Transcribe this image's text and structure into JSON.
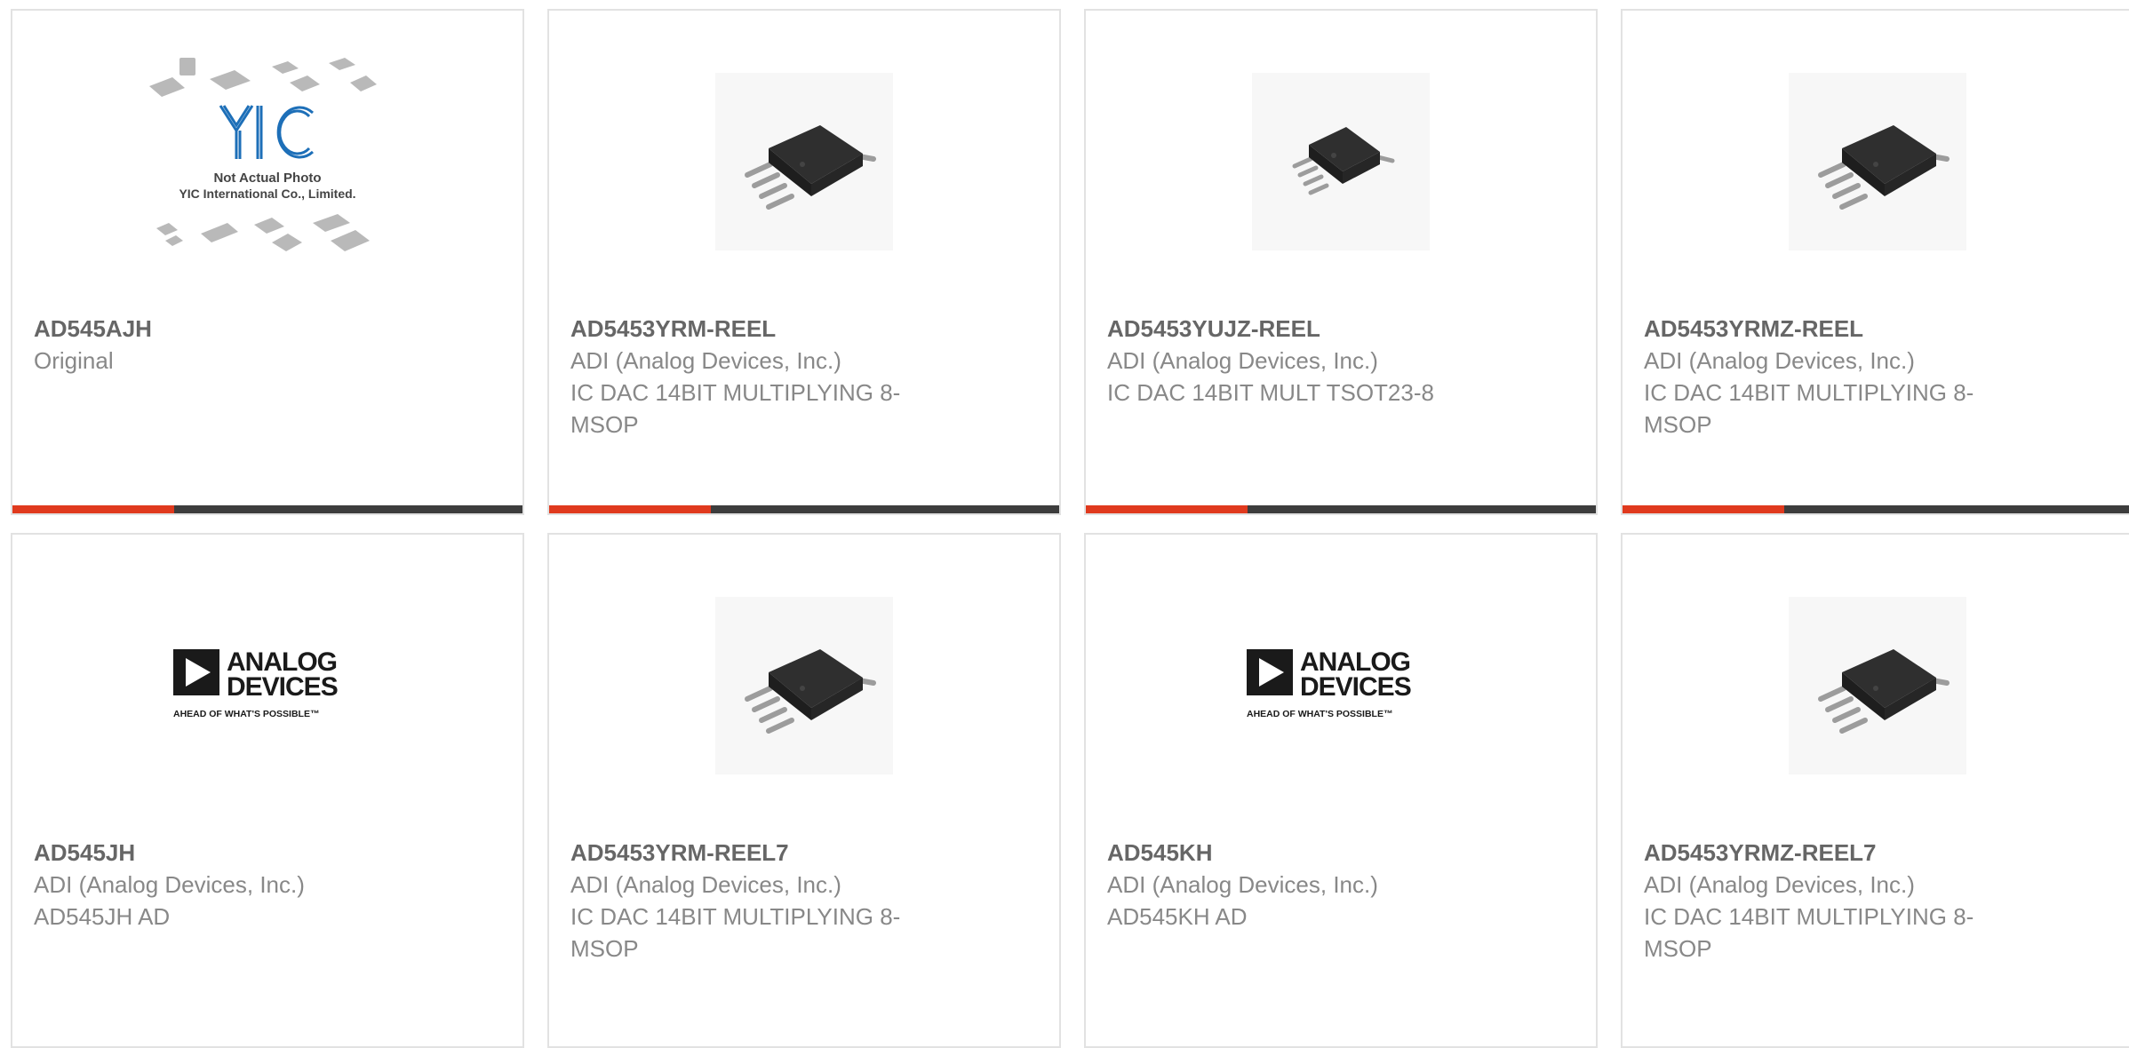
{
  "accent_color": "#e03a1e",
  "products": [
    {
      "part": "AD545AJH",
      "lines": [
        "Original"
      ],
      "image": "yic-placeholder",
      "yic": {
        "logo": "YIC",
        "caption1": "Not Actual Photo",
        "caption2": "YIC International Co., Limited."
      }
    },
    {
      "part": "AD5453YRM-REEL",
      "lines": [
        "ADI (Analog Devices, Inc.)",
        "IC DAC 14BIT MULTIPLYING 8-",
        "MSOP"
      ],
      "image": "msop-chip"
    },
    {
      "part": "AD5453YUJZ-REEL",
      "lines": [
        "ADI (Analog Devices, Inc.)",
        "IC DAC 14BIT MULT TSOT23-8"
      ],
      "image": "tsot-chip"
    },
    {
      "part": "AD5453YRMZ-REEL",
      "lines": [
        "ADI (Analog Devices, Inc.)",
        "IC DAC 14BIT MULTIPLYING 8-",
        "MSOP"
      ],
      "image": "msop-chip"
    },
    {
      "part": "AD545JH",
      "lines": [
        "ADI (Analog Devices, Inc.)",
        "AD545JH AD"
      ],
      "image": "analog-devices-logo",
      "logo": {
        "line1": "ANALOG",
        "line2": "DEVICES",
        "tagline": "AHEAD OF WHAT'S POSSIBLE™"
      }
    },
    {
      "part": "AD5453YRM-REEL7",
      "lines": [
        "ADI (Analog Devices, Inc.)",
        "IC DAC 14BIT MULTIPLYING 8-",
        "MSOP"
      ],
      "image": "msop-chip"
    },
    {
      "part": "AD545KH",
      "lines": [
        "ADI (Analog Devices, Inc.)",
        "AD545KH AD"
      ],
      "image": "analog-devices-logo",
      "logo": {
        "line1": "ANALOG",
        "line2": "DEVICES",
        "tagline": "AHEAD OF WHAT'S POSSIBLE™"
      }
    },
    {
      "part": "AD5453YRMZ-REEL7",
      "lines": [
        "ADI (Analog Devices, Inc.)",
        "IC DAC 14BIT MULTIPLYING 8-",
        "MSOP"
      ],
      "image": "msop-chip"
    }
  ]
}
